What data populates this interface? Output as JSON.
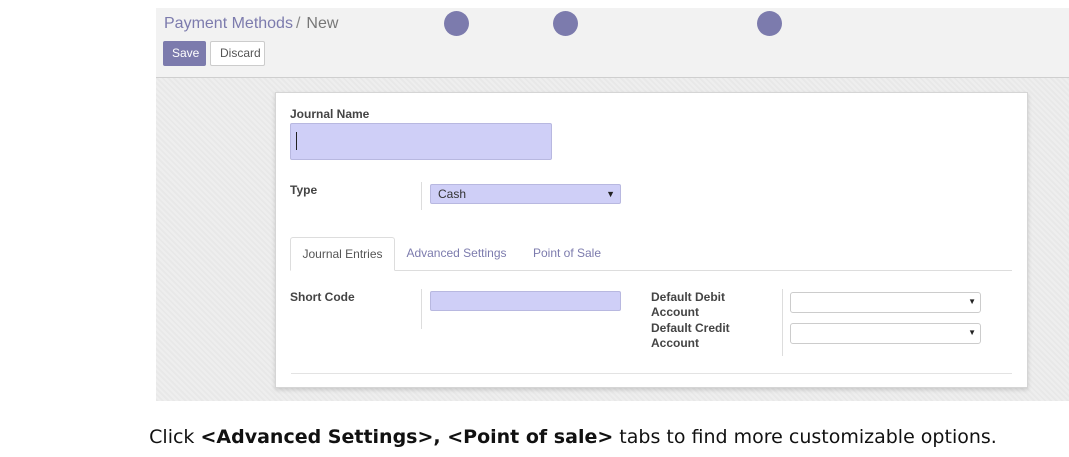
{
  "breadcrumb": {
    "parent": "Payment Methods",
    "separator": "/",
    "current": "New"
  },
  "buttons": {
    "save": "Save",
    "discard": "Discard"
  },
  "form": {
    "journal_name_label": "Journal Name",
    "journal_name_value": "",
    "type_label": "Type",
    "type_value": "Cash",
    "tabs": [
      {
        "label": "Journal Entries",
        "active": true
      },
      {
        "label": "Advanced Settings",
        "active": false
      },
      {
        "label": "Point of Sale",
        "active": false
      }
    ],
    "short_code_label": "Short Code",
    "short_code_value": "",
    "default_debit_label_1": "Default Debit",
    "default_debit_label_2": "Account",
    "default_credit_label_1": "Default Credit",
    "default_credit_label_2": "Account",
    "default_debit_value": "",
    "default_credit_value": ""
  },
  "caption": {
    "pre": "Click ",
    "bold": "<Advanced Settings>, <Point of sale>",
    "post": " tabs to find more customizable options."
  },
  "colors": {
    "accent": "#7c7bad",
    "input_fill": "#cfcff7"
  },
  "icons": {
    "dropdown": "caret-down-icon",
    "indicator": "circle-dot-icon"
  }
}
